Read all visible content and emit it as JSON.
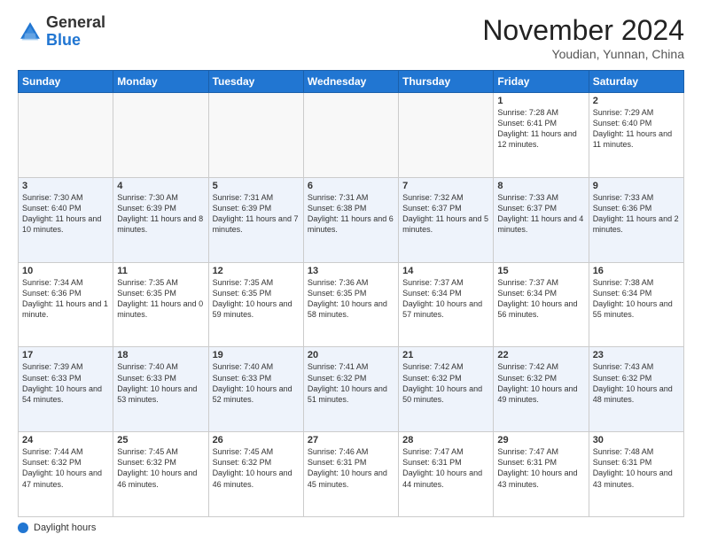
{
  "logo": {
    "text_general": "General",
    "text_blue": "Blue"
  },
  "header": {
    "month_title": "November 2024",
    "location": "Youdian, Yunnan, China"
  },
  "weekdays": [
    "Sunday",
    "Monday",
    "Tuesday",
    "Wednesday",
    "Thursday",
    "Friday",
    "Saturday"
  ],
  "footer": {
    "label": "Daylight hours"
  },
  "weeks": [
    [
      {
        "day": "",
        "info": ""
      },
      {
        "day": "",
        "info": ""
      },
      {
        "day": "",
        "info": ""
      },
      {
        "day": "",
        "info": ""
      },
      {
        "day": "",
        "info": ""
      },
      {
        "day": "1",
        "info": "Sunrise: 7:28 AM\nSunset: 6:41 PM\nDaylight: 11 hours and 12 minutes."
      },
      {
        "day": "2",
        "info": "Sunrise: 7:29 AM\nSunset: 6:40 PM\nDaylight: 11 hours and 11 minutes."
      }
    ],
    [
      {
        "day": "3",
        "info": "Sunrise: 7:30 AM\nSunset: 6:40 PM\nDaylight: 11 hours and 10 minutes."
      },
      {
        "day": "4",
        "info": "Sunrise: 7:30 AM\nSunset: 6:39 PM\nDaylight: 11 hours and 8 minutes."
      },
      {
        "day": "5",
        "info": "Sunrise: 7:31 AM\nSunset: 6:39 PM\nDaylight: 11 hours and 7 minutes."
      },
      {
        "day": "6",
        "info": "Sunrise: 7:31 AM\nSunset: 6:38 PM\nDaylight: 11 hours and 6 minutes."
      },
      {
        "day": "7",
        "info": "Sunrise: 7:32 AM\nSunset: 6:37 PM\nDaylight: 11 hours and 5 minutes."
      },
      {
        "day": "8",
        "info": "Sunrise: 7:33 AM\nSunset: 6:37 PM\nDaylight: 11 hours and 4 minutes."
      },
      {
        "day": "9",
        "info": "Sunrise: 7:33 AM\nSunset: 6:36 PM\nDaylight: 11 hours and 2 minutes."
      }
    ],
    [
      {
        "day": "10",
        "info": "Sunrise: 7:34 AM\nSunset: 6:36 PM\nDaylight: 11 hours and 1 minute."
      },
      {
        "day": "11",
        "info": "Sunrise: 7:35 AM\nSunset: 6:35 PM\nDaylight: 11 hours and 0 minutes."
      },
      {
        "day": "12",
        "info": "Sunrise: 7:35 AM\nSunset: 6:35 PM\nDaylight: 10 hours and 59 minutes."
      },
      {
        "day": "13",
        "info": "Sunrise: 7:36 AM\nSunset: 6:35 PM\nDaylight: 10 hours and 58 minutes."
      },
      {
        "day": "14",
        "info": "Sunrise: 7:37 AM\nSunset: 6:34 PM\nDaylight: 10 hours and 57 minutes."
      },
      {
        "day": "15",
        "info": "Sunrise: 7:37 AM\nSunset: 6:34 PM\nDaylight: 10 hours and 56 minutes."
      },
      {
        "day": "16",
        "info": "Sunrise: 7:38 AM\nSunset: 6:34 PM\nDaylight: 10 hours and 55 minutes."
      }
    ],
    [
      {
        "day": "17",
        "info": "Sunrise: 7:39 AM\nSunset: 6:33 PM\nDaylight: 10 hours and 54 minutes."
      },
      {
        "day": "18",
        "info": "Sunrise: 7:40 AM\nSunset: 6:33 PM\nDaylight: 10 hours and 53 minutes."
      },
      {
        "day": "19",
        "info": "Sunrise: 7:40 AM\nSunset: 6:33 PM\nDaylight: 10 hours and 52 minutes."
      },
      {
        "day": "20",
        "info": "Sunrise: 7:41 AM\nSunset: 6:32 PM\nDaylight: 10 hours and 51 minutes."
      },
      {
        "day": "21",
        "info": "Sunrise: 7:42 AM\nSunset: 6:32 PM\nDaylight: 10 hours and 50 minutes."
      },
      {
        "day": "22",
        "info": "Sunrise: 7:42 AM\nSunset: 6:32 PM\nDaylight: 10 hours and 49 minutes."
      },
      {
        "day": "23",
        "info": "Sunrise: 7:43 AM\nSunset: 6:32 PM\nDaylight: 10 hours and 48 minutes."
      }
    ],
    [
      {
        "day": "24",
        "info": "Sunrise: 7:44 AM\nSunset: 6:32 PM\nDaylight: 10 hours and 47 minutes."
      },
      {
        "day": "25",
        "info": "Sunrise: 7:45 AM\nSunset: 6:32 PM\nDaylight: 10 hours and 46 minutes."
      },
      {
        "day": "26",
        "info": "Sunrise: 7:45 AM\nSunset: 6:32 PM\nDaylight: 10 hours and 46 minutes."
      },
      {
        "day": "27",
        "info": "Sunrise: 7:46 AM\nSunset: 6:31 PM\nDaylight: 10 hours and 45 minutes."
      },
      {
        "day": "28",
        "info": "Sunrise: 7:47 AM\nSunset: 6:31 PM\nDaylight: 10 hours and 44 minutes."
      },
      {
        "day": "29",
        "info": "Sunrise: 7:47 AM\nSunset: 6:31 PM\nDaylight: 10 hours and 43 minutes."
      },
      {
        "day": "30",
        "info": "Sunrise: 7:48 AM\nSunset: 6:31 PM\nDaylight: 10 hours and 43 minutes."
      }
    ]
  ]
}
